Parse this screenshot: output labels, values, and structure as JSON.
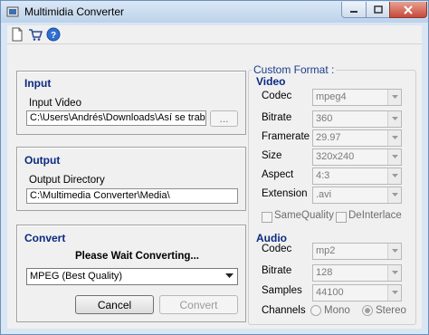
{
  "window": {
    "title": "Multimidia Converter"
  },
  "input": {
    "title": "Input",
    "video_label": "Input Video",
    "video_path": "C:\\Users\\Andrés\\Downloads\\Así se trabaja",
    "browse_label": "..."
  },
  "output": {
    "title": "Output",
    "dir_label": "Output Directory",
    "dir_path": "C:\\Multimedia Converter\\Media\\"
  },
  "convert": {
    "title": "Convert",
    "status": "Please Wait Converting...",
    "preset": "MPEG (Best Quality)",
    "cancel_label": "Cancel",
    "convert_label": "Convert"
  },
  "custom": {
    "legend": "Custom Format :",
    "video": {
      "title": "Video",
      "codec_label": "Codec",
      "codec": "mpeg4",
      "bitrate_label": "Bitrate",
      "bitrate": "360",
      "framerate_label": "Framerate",
      "framerate": "29.97",
      "size_label": "Size",
      "size": "320x240",
      "aspect_label": "Aspect",
      "aspect": "4:3",
      "extension_label": "Extension",
      "extension": ".avi",
      "same_quality_label": "SameQuality",
      "deinterlace_label": "DeInterlace"
    },
    "audio": {
      "title": "Audio",
      "codec_label": "Codec",
      "codec": "mp2",
      "bitrate_label": "Bitrate",
      "bitrate": "128",
      "samples_label": "Samples",
      "samples": "44100",
      "channels_label": "Channels",
      "mono_label": "Mono",
      "stereo_label": "Stereo"
    }
  },
  "icons": [
    "app-icon",
    "new-file-icon",
    "cart-icon",
    "help-icon",
    "minimize-icon",
    "maximize-icon",
    "close-icon"
  ]
}
